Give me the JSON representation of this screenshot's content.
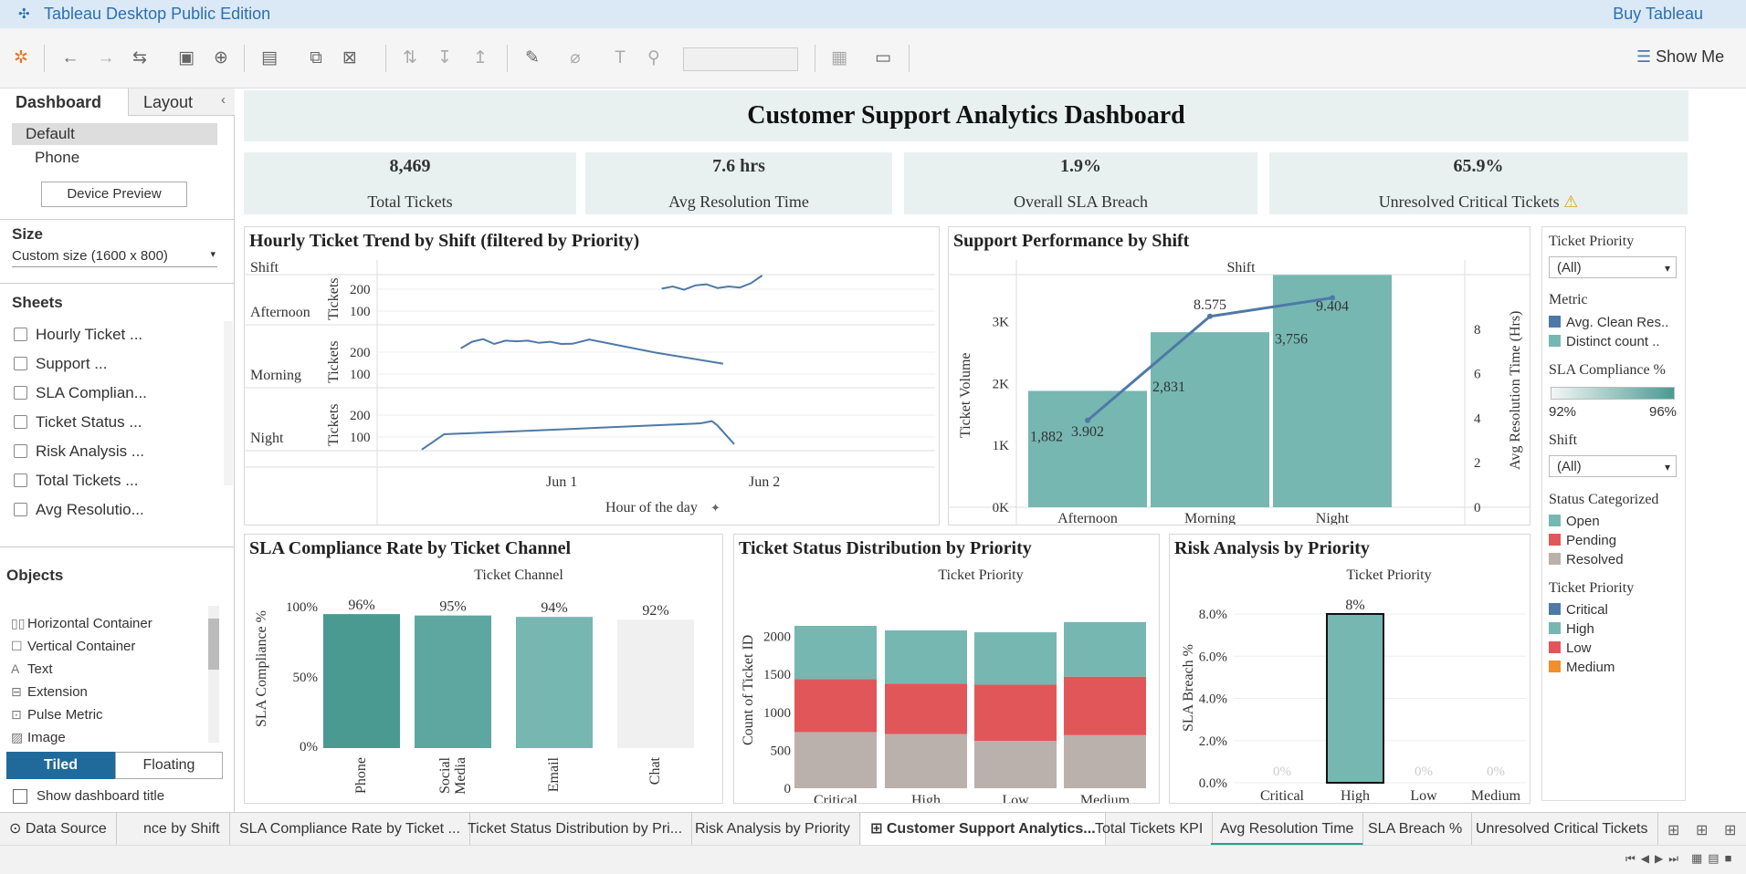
{
  "app": {
    "title": "Tableau Desktop Public Edition",
    "buy": "Buy Tableau",
    "show_me": "Show Me"
  },
  "left": {
    "tabs": [
      "Dashboard",
      "Layout"
    ],
    "device": [
      "Default",
      "Phone"
    ],
    "device_preview": "Device Preview",
    "size_title": "Size",
    "size_value": "Custom size (1600 x 800)",
    "sheets_title": "Sheets",
    "sheets": [
      "Hourly Ticket ...",
      "Support ...",
      "SLA Complian...",
      "Ticket Status ...",
      "Risk Analysis ...",
      "Total Tickets ...",
      "Avg Resolutio..."
    ],
    "objects_title": "Objects",
    "objects": [
      "Horizontal Container",
      "Vertical Container",
      "Text",
      "Extension",
      "Pulse Metric",
      "Image"
    ],
    "tiled": "Tiled",
    "floating": "Floating",
    "show_title": "Show dashboard title"
  },
  "dashboard": {
    "title": "Customer Support Analytics Dashboard",
    "kpis": [
      {
        "value": "8,469",
        "label": "Total Tickets"
      },
      {
        "value": "7.6 hrs",
        "label": "Avg Resolution Time"
      },
      {
        "value": "1.9%",
        "label": "Overall SLA Breach"
      },
      {
        "value": "65.9%",
        "label": "Unresolved Critical Tickets"
      }
    ]
  },
  "filters": {
    "priority_title": "Ticket Priority",
    "priority_value": "(All)",
    "metric_title": "Metric",
    "metrics": [
      "Avg. Clean Res..",
      "Distinct count .."
    ],
    "sla_title": "SLA Compliance %",
    "sla_min": "92%",
    "sla_max": "96%",
    "shift_title": "Shift",
    "shift_value": "(All)",
    "status_title": "Status Categorized",
    "statuses": [
      "Open",
      "Pending",
      "Resolved"
    ],
    "priority_legend_title": "Ticket Priority",
    "priorities": [
      "Critical",
      "High",
      "Low",
      "Medium"
    ]
  },
  "colors": {
    "open": "#76b7b2",
    "pending": "#e15759",
    "resolved": "#bab0ac",
    "critical": "#4e79a7",
    "high": "#76b7b2",
    "low": "#e15759",
    "medium": "#f28e2b",
    "line": "#4e79a7"
  },
  "hourly": {
    "title": "Hourly Ticket Trend by Shift (filtered by Priority)",
    "shift_header": "Shift",
    "rows": [
      "Afternoon",
      "Morning",
      "Night"
    ],
    "ylabel": "Tickets",
    "yticks": [
      "200",
      "100"
    ],
    "xticks": [
      "Jun 1",
      "Jun 2"
    ],
    "xlabel": "Hour of the day"
  },
  "support": {
    "title": "Support Performance by Shift",
    "header": "Shift",
    "ylabel_left": "Ticket Volume",
    "ylabel_right": "Avg Resolution Time (Hrs)",
    "left_ticks": [
      "3K",
      "2K",
      "1K",
      "0K"
    ],
    "right_ticks": [
      "8",
      "6",
      "4",
      "2",
      "0"
    ]
  },
  "sla": {
    "title": "SLA Compliance Rate by Ticket Channel",
    "header": "Ticket Channel",
    "ylabel": "SLA Compliance %",
    "ticks": [
      "100%",
      "50%",
      "0%"
    ]
  },
  "status": {
    "title": "Ticket Status Distribution by Priority",
    "header": "Ticket Priority",
    "ylabel": "Count of Ticket ID",
    "ticks": [
      "2000",
      "1500",
      "1000",
      "500",
      "0"
    ]
  },
  "risk": {
    "title": "Risk Analysis by Priority",
    "header": "Ticket Priority",
    "ylabel": "SLA Breach %",
    "ticks": [
      "8.0%",
      "6.0%",
      "4.0%",
      "2.0%",
      "0.0%"
    ]
  },
  "chart_data": [
    {
      "type": "line",
      "title": "Hourly Ticket Trend by Shift (filtered by Priority)",
      "xlabel": "Hour of the day",
      "ylabel": "Tickets",
      "x_ticks": [
        "Jun 1",
        "Jun 2"
      ],
      "series": [
        {
          "name": "Afternoon",
          "values": [
            [
              0.51,
              165
            ],
            [
              0.53,
              175
            ],
            [
              0.55,
              160
            ],
            [
              0.57,
              180
            ],
            [
              0.59,
              185
            ],
            [
              0.61,
              168
            ],
            [
              0.63,
              175
            ],
            [
              0.65,
              170
            ],
            [
              0.67,
              190
            ],
            [
              0.69,
              225
            ]
          ]
        },
        {
          "name": "Morning",
          "values": [
            [
              0.15,
              180
            ],
            [
              0.17,
              210
            ],
            [
              0.19,
              222
            ],
            [
              0.21,
              200
            ],
            [
              0.23,
              215
            ],
            [
              0.25,
              212
            ],
            [
              0.27,
              215
            ],
            [
              0.29,
              205
            ],
            [
              0.31,
              210
            ],
            [
              0.33,
              200
            ],
            [
              0.35,
              201
            ],
            [
              0.38,
              220
            ],
            [
              0.5,
              160
            ],
            [
              0.62,
              110
            ]
          ]
        },
        {
          "name": "Night",
          "values": [
            [
              0.08,
              5
            ],
            [
              0.12,
              75
            ],
            [
              0.4,
              105
            ],
            [
              0.58,
              125
            ],
            [
              0.6,
              135
            ],
            [
              0.61,
              115
            ],
            [
              0.64,
              30
            ]
          ]
        }
      ]
    },
    {
      "type": "bar",
      "title": "Support Performance by Shift",
      "categories": [
        "Afternoon",
        "Morning",
        "Night"
      ],
      "series": [
        {
          "name": "Distinct count of Ticket ID",
          "values": [
            1882,
            2831,
            3756
          ]
        },
        {
          "name": "Avg. Clean Resolution Hours",
          "values": [
            3.902,
            8.575,
            9.404
          ]
        }
      ],
      "data_labels": {
        "bars": [
          "1,882",
          "2,831",
          "3,756"
        ],
        "line": [
          "3.902",
          "8.575",
          "9.404"
        ]
      },
      "ylim": [
        0,
        3600
      ],
      "y2lim": [
        0,
        10
      ]
    },
    {
      "type": "bar",
      "title": "SLA Compliance Rate by Ticket Channel",
      "categories": [
        "Phone",
        "Social Media",
        "Email",
        "Chat"
      ],
      "values": [
        96,
        95,
        94,
        92
      ],
      "labels": [
        "96%",
        "95%",
        "94%",
        "92%"
      ],
      "colors": [
        "#4a9a92",
        "#5ea7a0",
        "#76b7b2",
        "#f0f0f0"
      ],
      "ylim": [
        0,
        100
      ]
    },
    {
      "type": "bar",
      "title": "Ticket Status Distribution by Priority",
      "categories": [
        "Critical",
        "High",
        "Low",
        "Medium"
      ],
      "series": [
        {
          "name": "Resolved",
          "values": [
            740,
            715,
            625,
            700
          ]
        },
        {
          "name": "Pending",
          "values": [
            700,
            665,
            740,
            770
          ]
        },
        {
          "name": "Open",
          "values": [
            700,
            700,
            690,
            720
          ]
        }
      ],
      "ylim": [
        0,
        2200
      ]
    },
    {
      "type": "bar",
      "title": "Risk Analysis by Priority",
      "categories": [
        "Critical",
        "High",
        "Low",
        "Medium"
      ],
      "values": [
        0,
        8,
        0,
        0
      ],
      "labels": [
        "0%",
        "8%",
        "0%",
        "0%"
      ],
      "ylim": [
        0,
        8.6
      ]
    }
  ],
  "bottom_tabs": [
    "Data Source",
    "nce by Shift",
    "SLA Compliance Rate by Ticket ...",
    "Ticket Status Distribution by Pri...",
    "Risk Analysis by Priority",
    "Customer Support Analytics...",
    "Total Tickets KPI",
    "Avg Resolution Time",
    "SLA Breach %",
    "Unresolved Critical Tickets"
  ]
}
